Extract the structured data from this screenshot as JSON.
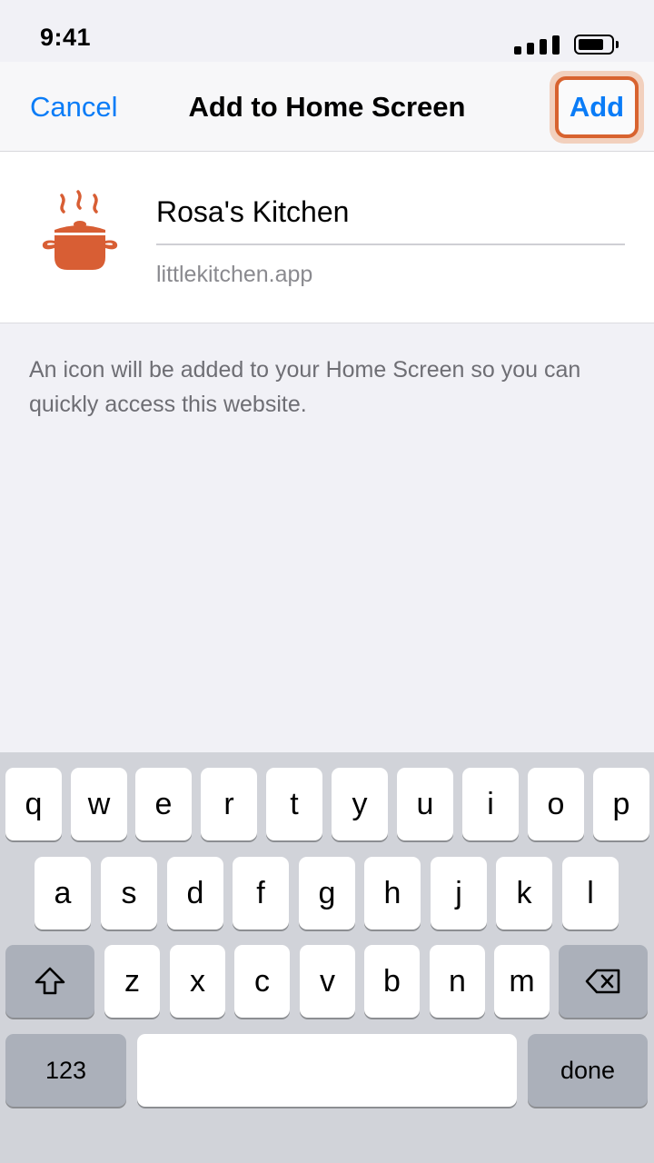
{
  "status_bar": {
    "time": "9:41"
  },
  "nav": {
    "cancel_label": "Cancel",
    "title": "Add to Home Screen",
    "add_label": "Add"
  },
  "form": {
    "site_name": "Rosa's Kitchen",
    "url": "littlekitchen.app",
    "icon": "cooking-pot-icon",
    "icon_color": "#d85e34"
  },
  "info_text": "An icon will be added to your Home Screen so you can quickly access this website.",
  "colors": {
    "accent": "#0a7cf7",
    "highlight": "#d8632f"
  },
  "keyboard": {
    "row1": [
      "q",
      "w",
      "e",
      "r",
      "t",
      "y",
      "u",
      "i",
      "o",
      "p"
    ],
    "row2": [
      "a",
      "s",
      "d",
      "f",
      "g",
      "h",
      "j",
      "k",
      "l"
    ],
    "row3": [
      "z",
      "x",
      "c",
      "v",
      "b",
      "n",
      "m"
    ],
    "numbers_label": "123",
    "done_label": "done"
  }
}
